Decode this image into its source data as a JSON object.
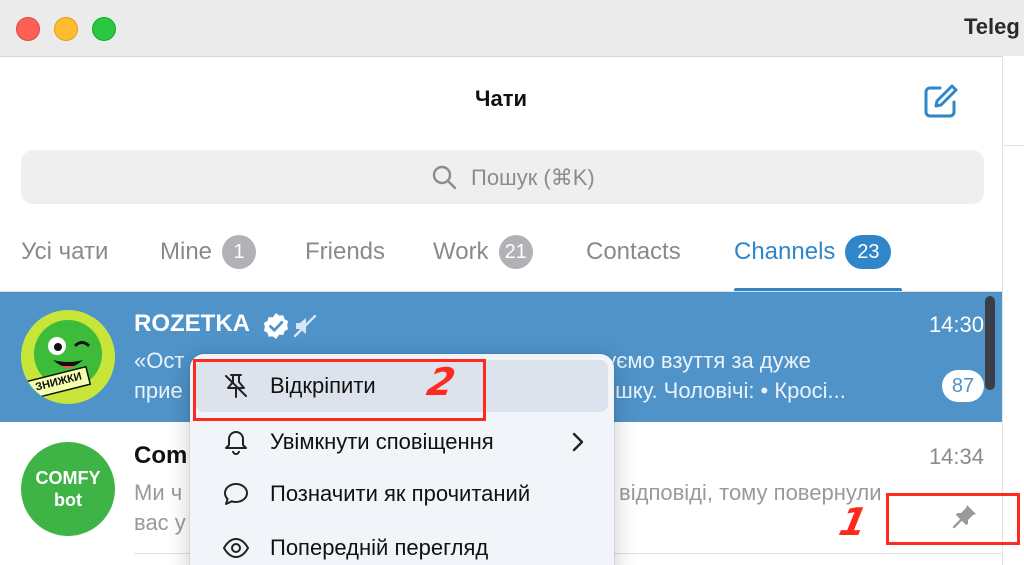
{
  "window": {
    "app_title": "Teleg"
  },
  "header": {
    "title": "Чати"
  },
  "search": {
    "placeholder": "Пошук (⌘K)"
  },
  "tabs": [
    {
      "label": "Усі чати",
      "badge": ""
    },
    {
      "label": "Mine",
      "badge": "1"
    },
    {
      "label": "Friends",
      "badge": ""
    },
    {
      "label": "Work",
      "badge": "21"
    },
    {
      "label": "Contacts",
      "badge": ""
    },
    {
      "label": "Channels",
      "badge": "23"
    }
  ],
  "chats": [
    {
      "name": "ROZETKA",
      "time": "14:30",
      "preview_line1": "«Ост",
      "preview_line1_right": "вуємо взуття за дуже",
      "preview_line2": "прие",
      "preview_line2_right": "лишку. Чоловічі: • Кросі...",
      "unread": "87",
      "avatar_text": "ЗНИЖКИ"
    },
    {
      "name": "Com",
      "time": "14:34",
      "preview_line1": "Ми ч",
      "preview_line1_right": "ся відповіді, тому повернули",
      "preview_line2": "вас у",
      "avatar_line1": "COMFY",
      "avatar_line2": "bot"
    }
  ],
  "context_menu": {
    "items": [
      {
        "label": "Відкріпити",
        "icon": "unpin-icon"
      },
      {
        "label": "Увімкнути сповіщення",
        "icon": "bell-icon"
      },
      {
        "label": "Позначити як прочитаний",
        "icon": "chat-bubble-icon"
      },
      {
        "label": "Попередній перегляд",
        "icon": "eye-icon"
      }
    ]
  },
  "annotations": {
    "one": "1",
    "two": "2"
  },
  "colors": {
    "accent": "#2f86c8",
    "selected_row": "#4f93c9",
    "annotation": "#ff2a1f"
  }
}
